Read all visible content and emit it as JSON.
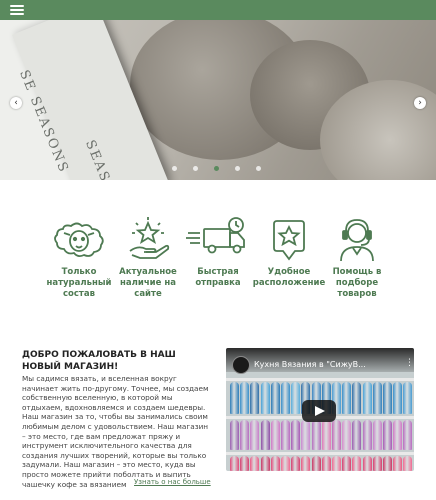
{
  "header": {
    "menu_icon": "hamburger-menu-icon",
    "bar_color": "#5a8a5e"
  },
  "hero": {
    "paper_text_1": "SE SEASONS",
    "paper_text_2": "SEASO",
    "prev_glyph": "‹",
    "next_glyph": "›",
    "slide_count": 5,
    "active_slide": 3
  },
  "features": [
    {
      "icon": "sheep-icon",
      "label": "Только натуральный состав"
    },
    {
      "icon": "star-hand-icon",
      "label": "Актуальное наличие на сайте"
    },
    {
      "icon": "delivery-truck-icon",
      "label": "Быстрая отправка"
    },
    {
      "icon": "location-pin-star-icon",
      "label": "Удобное расположение"
    },
    {
      "icon": "support-headset-icon",
      "label": "Помощь в подборе товаров"
    }
  ],
  "welcome": {
    "title": "ДОБРО ПОЖАЛОВАТЬ В НАШ НОВЫЙ МАГАЗИН!",
    "body": "Мы садимся вязать, и вселенная вокруг начинает жить по-другому. Точнее, мы создаем собственную вселенную, в которой мы отдыхаем, вдохновляемся и создаем шедевры. Наш магазин за то, чтобы вы занимались своим любимым делом с удовольствием. Наш магазин – это место, где вам предложат пряжу и инструмент исключительного качества для создания лучших творений, которые вы только задумали. Наш магазин – это место, куда вы просто можете прийти поболтать и выпить чашечку кофе за вязанием",
    "more_link": "Узнать о нас больше"
  },
  "video": {
    "title": "Кухня Вязания в \"СижуВ...",
    "menu_glyph": "⋮"
  },
  "colors": {
    "accent": "#4e7a52",
    "bar": "#5a8a5e"
  }
}
